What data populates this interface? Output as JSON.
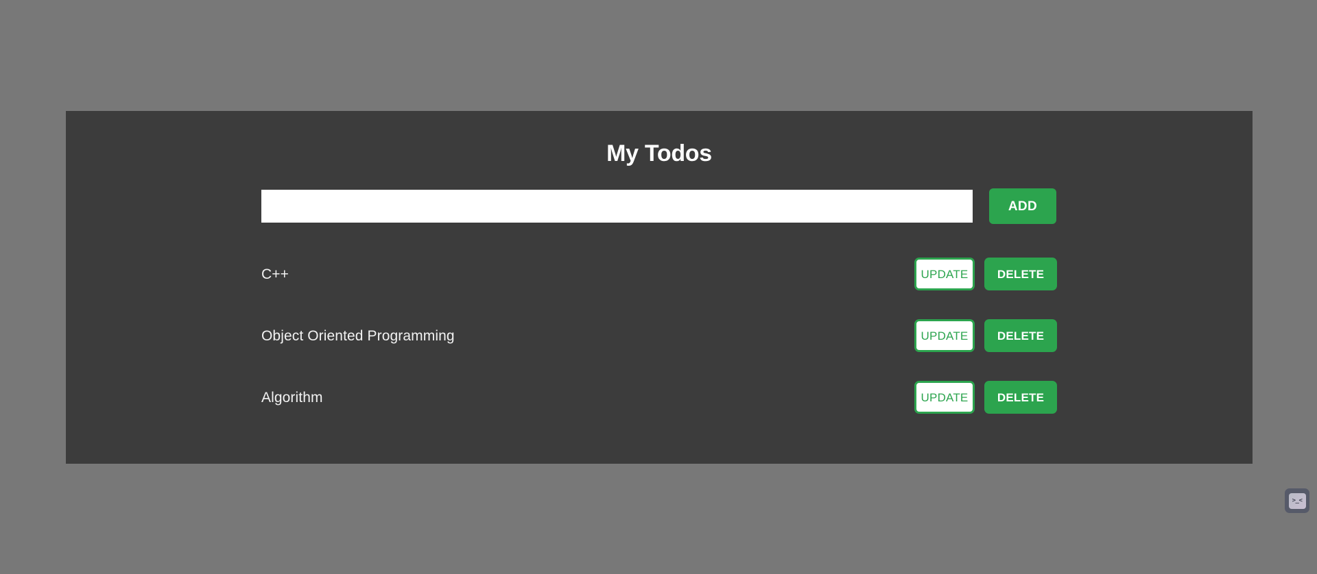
{
  "app": {
    "title": "My Todos",
    "background_color": "#787878",
    "card_color": "#3c3c3c",
    "accent_color": "#2ca44e"
  },
  "add_form": {
    "input_value": "",
    "input_placeholder": "",
    "add_label": "ADD"
  },
  "actions": {
    "update_label": "UPDATE",
    "delete_label": "DELETE"
  },
  "todos": [
    {
      "text": "C++"
    },
    {
      "text": "Object Oriented Programming"
    },
    {
      "text": "Algorithm"
    }
  ],
  "corner": {
    "terminal_glyph": ">_<",
    "icon": "terminal-icon"
  }
}
